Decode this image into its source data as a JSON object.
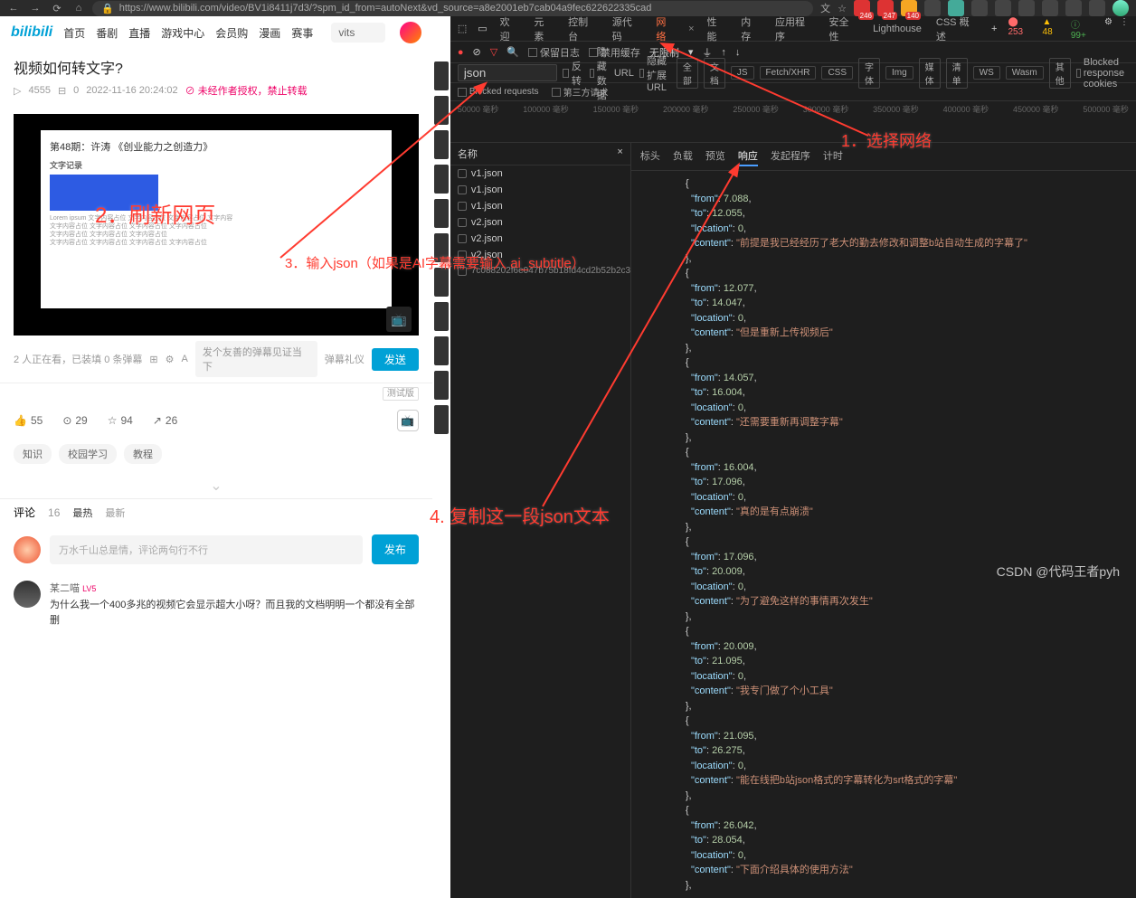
{
  "browser": {
    "url": "https://www.bilibili.com/video/BV1i8411j7d3/?spm_id_from=autoNext&vd_source=a8e2001eb7cab04a9fec622622335cad",
    "ext_badges": [
      "246",
      "247",
      "140"
    ]
  },
  "bili": {
    "logo": "bilibili",
    "nav": [
      "首页",
      "番剧",
      "直播",
      "游戏中心",
      "会员购",
      "漫画",
      "赛事"
    ],
    "search_value": "vits",
    "video_title": "视频如何转文字?",
    "views": "4555",
    "danmu_cnt": "0",
    "date": "2022-11-16 20:24:02",
    "warn": "未经作者授权，禁止转载",
    "slide_title": "第48期：许涛 《创业能力之创造力》",
    "status_line": "2 人正在看，已装填 0 条弹幕",
    "danmu_placeholder": "发个友善的弹幕见证当下",
    "danmu_setting": "弹幕礼仪",
    "send": "发送",
    "test_btn": "测试版",
    "likes": "55",
    "coins": "29",
    "favs": "94",
    "shares": "26",
    "tags": [
      "知识",
      "校园学习",
      "教程"
    ],
    "comment_label": "评论",
    "comment_count": "16",
    "sort_hot": "最热",
    "sort_new": "最新",
    "comment_placeholder": "万水千山总是情，评论两句行不行",
    "publish": "发布",
    "c1_name": "某二喵",
    "c1_badge": "LV5",
    "c1_text": "为什么我一个400多兆的视频它会显示超大小呀？而且我的文档明明一个都没有全部删"
  },
  "devtools": {
    "tabs": [
      "欢迎",
      "元素",
      "控制台",
      "源代码",
      "网络",
      "性能",
      "内存",
      "应用程序",
      "安全性",
      "Lighthouse",
      "CSS 概述"
    ],
    "active_tab": "网络",
    "badges": {
      "errors": "253",
      "warnings": "48",
      "info": "99+"
    },
    "toolbar": {
      "keep_log": "保留日志",
      "disable_cache": "禁用缓存",
      "throttle": "无限制"
    },
    "filter_value": "json",
    "filter_opts": {
      "invert": "反转",
      "hide_data": "隐藏数据",
      "hide_url": "隐藏扩展 URL",
      "blocked_cookies": "Blocked response cookies"
    },
    "filter_types": [
      "全部",
      "文档",
      "JS",
      "Fetch/XHR",
      "CSS",
      "字体",
      "Img",
      "媒体",
      "清单",
      "WS",
      "Wasm",
      "其他"
    ],
    "blocked": {
      "requests": "Blocked requests",
      "third_party": "第三方请求"
    },
    "timeline_ticks": [
      "50000 毫秒",
      "100000 毫秒",
      "150000 毫秒",
      "200000 毫秒",
      "250000 毫秒",
      "300000 毫秒",
      "350000 毫秒",
      "400000 毫秒",
      "450000 毫秒",
      "500000 毫秒"
    ],
    "name_header": "名称",
    "requests": [
      "v1.json",
      "v1.json",
      "v1.json",
      "v2.json",
      "v2.json",
      "v2.json",
      "7c088202f6e047b75b18fd4cd2b52b2c34c..."
    ],
    "detail_tabs": [
      "标头",
      "负载",
      "预览",
      "响应",
      "发起程序",
      "计时"
    ],
    "active_detail": "响应",
    "json_entries": [
      {
        "from": "7.088",
        "to": "12.055",
        "location": "0",
        "content": "前提是我已经经历了老大的勤去修改和调整b站自动生成的字幕了"
      },
      {
        "from": "12.077",
        "to": "14.047",
        "location": "0",
        "content": "但是重新上传视频后"
      },
      {
        "from": "14.057",
        "to": "16.004",
        "location": "0",
        "content": "还需要重新再调整字幕"
      },
      {
        "from": "16.004",
        "to": "17.096",
        "location": "0",
        "content": "真的是有点崩溃"
      },
      {
        "from": "17.096",
        "to": "20.009",
        "location": "0",
        "content": "为了避免这样的事情再次发生"
      },
      {
        "from": "20.009",
        "to": "21.095",
        "location": "0",
        "content": "我专门做了个小工具"
      },
      {
        "from": "21.095",
        "to": "26.275",
        "location": "0",
        "content": "能在线把b站json格式的字幕转化为srt格式的字幕"
      },
      {
        "from": "26.042",
        "to": "28.054",
        "location": "0",
        "content": "下面介绍具体的使用方法"
      }
    ]
  },
  "annotations": {
    "a1": "1．选择网络",
    "a2": "2．刷新网页",
    "a3": "3．输入json（如果是AI字幕需要输入 ai_subtitle）",
    "a4": "4.   复制这一段json文本"
  },
  "watermark": "CSDN @代码王者pyh"
}
